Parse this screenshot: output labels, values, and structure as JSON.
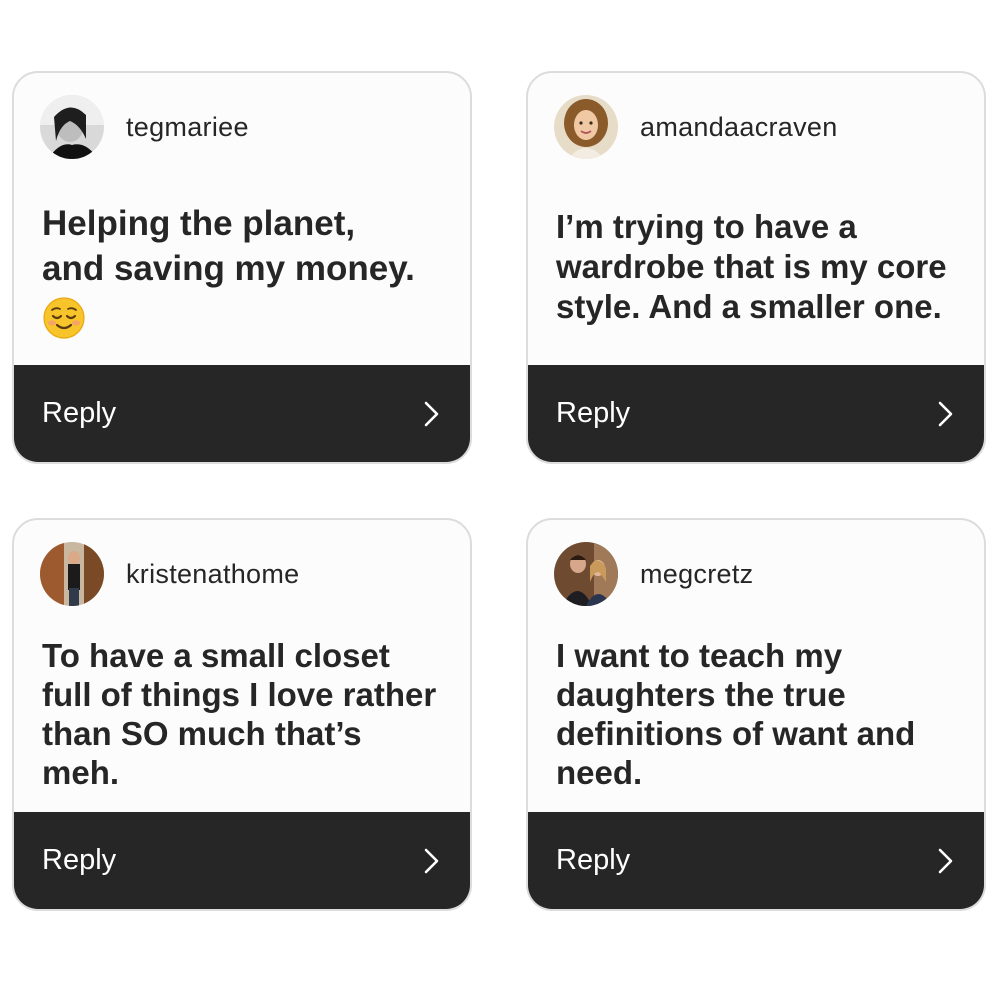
{
  "cards": [
    {
      "username": "tegmariee",
      "avatar": "avatar-photo-tegmariee",
      "message": "Helping the planet,\nand saving my money.",
      "emoji": "smiling-face-emoji",
      "reply_label": "Reply",
      "chevron": "chevron-right-icon"
    },
    {
      "username": "amandaacraven",
      "avatar": "avatar-photo-amandaacraven",
      "message": "I’m trying to have a\nwardrobe that is my core\nstyle. And a smaller one.",
      "reply_label": "Reply",
      "chevron": "chevron-right-icon"
    },
    {
      "username": "kristenathome",
      "avatar": "avatar-photo-kristenathome",
      "message": "To have a small closet\nfull of things I love rather\nthan SO much that’s\nmeh.",
      "reply_label": "Reply",
      "chevron": "chevron-right-icon"
    },
    {
      "username": "megcretz",
      "avatar": "avatar-photo-megcretz",
      "message": "I want to teach my\ndaughters the true\ndefinitions of want and\nneed.",
      "reply_label": "Reply",
      "chevron": "chevron-right-icon"
    }
  ],
  "colors": {
    "reply_bar": "#262626",
    "card_background": "#fcfcfc",
    "card_border": "#dcdcdc",
    "text": "#262626"
  }
}
